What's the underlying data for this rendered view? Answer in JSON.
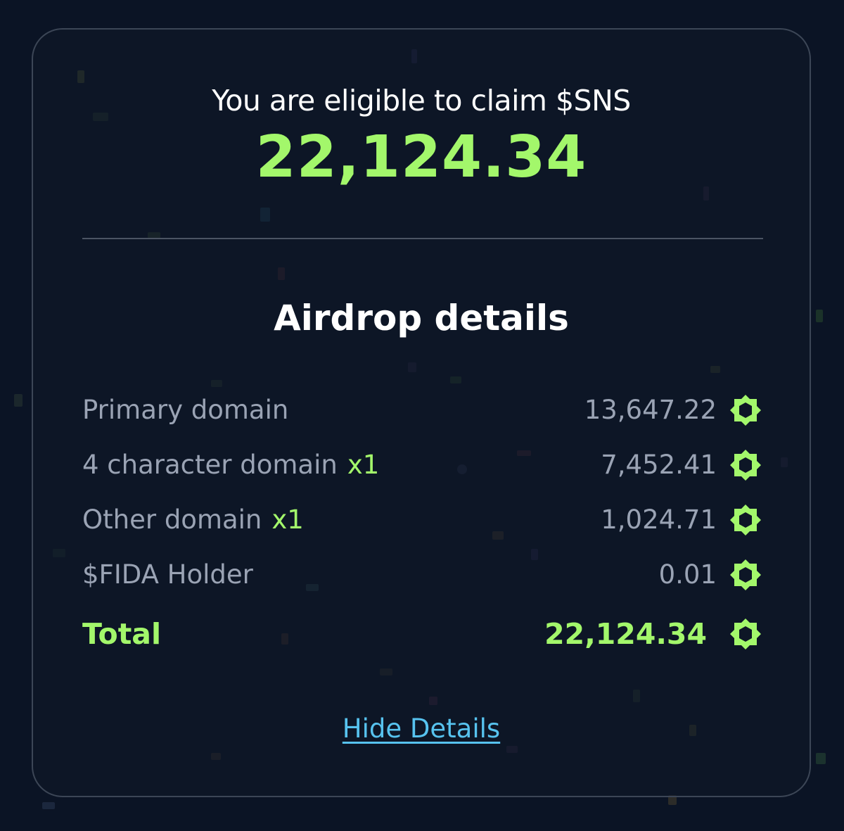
{
  "colors": {
    "background": "#0b1425",
    "accent_green": "#a3f76b",
    "muted_text": "#9aa3b4",
    "link": "#57c3ef"
  },
  "header": {
    "eligible_text": "You are eligible to claim $SNS",
    "amount": "22,124.34"
  },
  "details": {
    "title": "Airdrop details",
    "rows": [
      {
        "label": "Primary domain",
        "multiplier": "",
        "value": "13,647.22",
        "icon": "sns-token-icon"
      },
      {
        "label": "4 character domain",
        "multiplier": "x1",
        "value": "7,452.41",
        "icon": "sns-token-icon"
      },
      {
        "label": "Other domain",
        "multiplier": "x1",
        "value": "1,024.71",
        "icon": "sns-token-icon"
      },
      {
        "label": "$FIDA Holder",
        "multiplier": "",
        "value": "0.01",
        "icon": "sns-token-icon"
      }
    ],
    "total": {
      "label": "Total",
      "value": "22,124.34",
      "icon": "sns-token-icon"
    }
  },
  "actions": {
    "hide_details_label": "Hide Details"
  }
}
